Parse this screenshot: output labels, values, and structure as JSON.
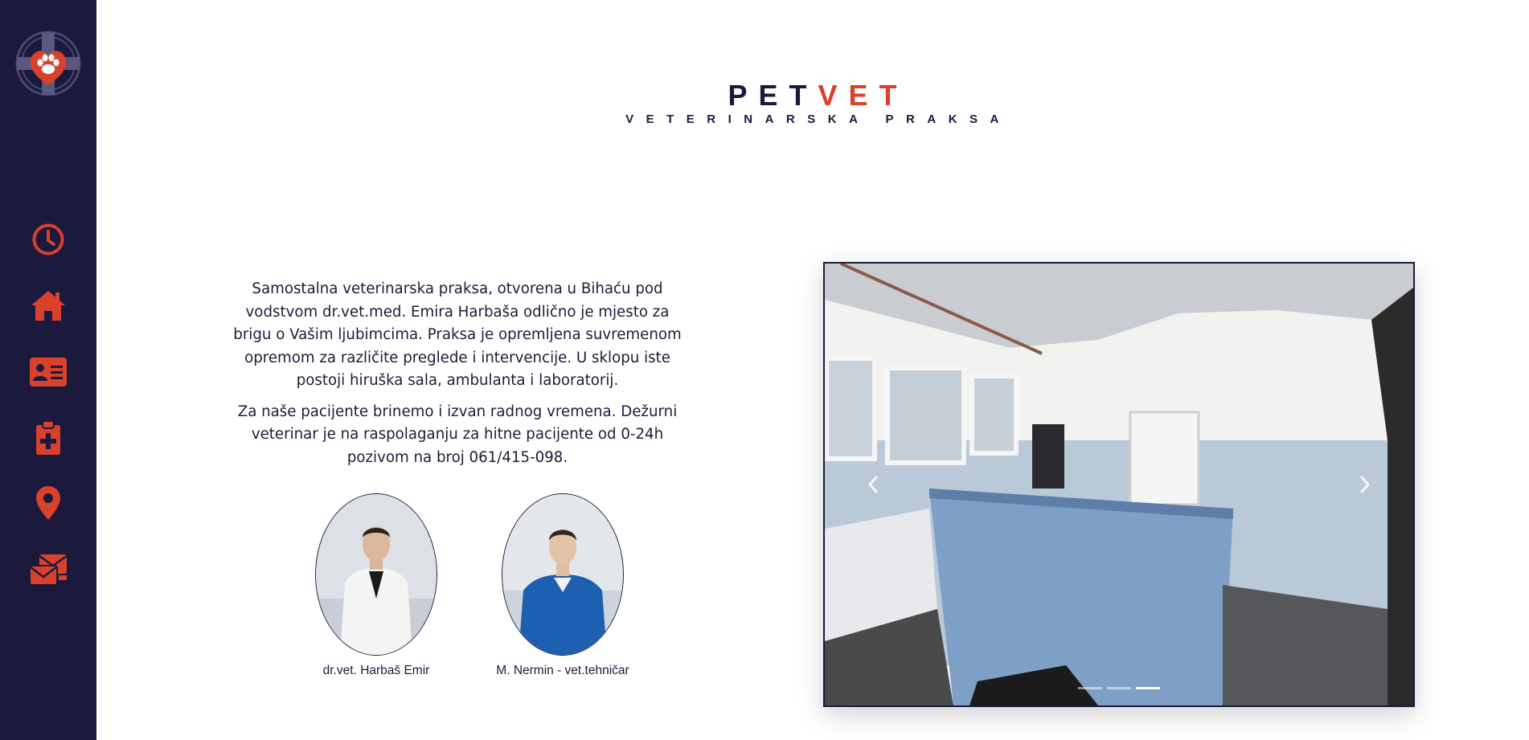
{
  "brand": {
    "title_part1": "PET",
    "title_part2": "VET",
    "subtitle": "VETERINARSKA PRAKSA"
  },
  "colors": {
    "sidebar": "#1b1a3d",
    "accent": "#d9412b",
    "text": "#1c1b3a"
  },
  "sidebar": {
    "logo_icon": "paw-heart-logo-icon",
    "items": [
      {
        "name": "clock-icon"
      },
      {
        "name": "home-icon"
      },
      {
        "name": "id-card-icon"
      },
      {
        "name": "clipboard-medical-icon"
      },
      {
        "name": "map-pin-icon"
      },
      {
        "name": "mail-icon"
      }
    ]
  },
  "intro": {
    "paragraph1": "Samostalna veterinarska praksa, otvorena u Bihaću pod vodstvom dr.vet.med. Emira Harbaša odlično je mjesto za brigu o Vašim ljubimcima. Praksa je opremljena suvremenom opremom za različite preglede i intervencije. U sklopu iste postoji hiruška sala, ambulanta i laboratorij.",
    "paragraph2": "Za naše pacijente brinemo i izvan radnog vremena. Dežurni veterinar je na raspolaganju za hitne pacijente od 0-24h pozivom na broj 061/415-098."
  },
  "staff": [
    {
      "caption": "dr.vet. Harbaš Emir"
    },
    {
      "caption": "M. Nermin - vet.tehničar"
    }
  ],
  "carousel": {
    "slide_count": 3,
    "active_index": 2,
    "prev_icon": "chevron-left-icon",
    "next_icon": "chevron-right-icon"
  }
}
